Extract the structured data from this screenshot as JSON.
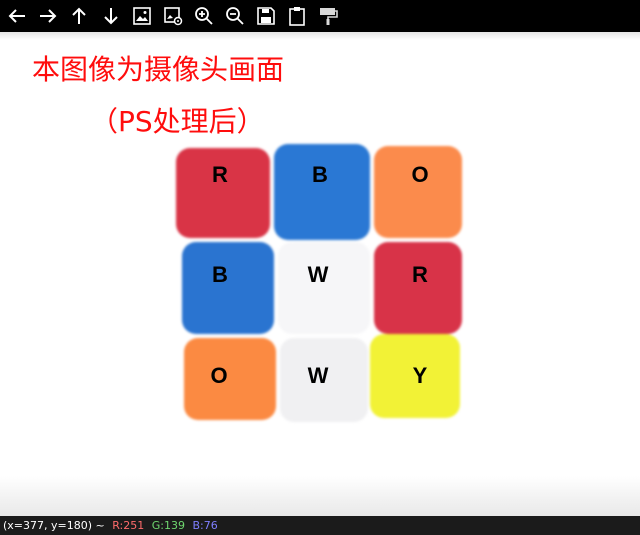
{
  "toolbar": {
    "buttons": [
      {
        "name": "back-button",
        "icon": "arrow-left-icon"
      },
      {
        "name": "forward-button",
        "icon": "arrow-right-icon"
      },
      {
        "name": "up-button",
        "icon": "arrow-up-icon"
      },
      {
        "name": "down-button",
        "icon": "arrow-down-icon"
      },
      {
        "name": "image-button",
        "icon": "image-icon"
      },
      {
        "name": "image-properties-button",
        "icon": "image-settings-icon"
      },
      {
        "name": "zoom-in-button",
        "icon": "zoom-in-icon"
      },
      {
        "name": "zoom-out-button",
        "icon": "zoom-out-icon"
      },
      {
        "name": "save-button",
        "icon": "save-icon"
      },
      {
        "name": "clipboard-button",
        "icon": "clipboard-icon"
      },
      {
        "name": "paint-button",
        "icon": "paint-roller-icon"
      }
    ]
  },
  "image": {
    "caption_line1": "本图像为摄像头画面",
    "caption_line2": "（PS处理后）",
    "cube_faces": [
      {
        "label": "R",
        "color": "#d93446"
      },
      {
        "label": "B",
        "color": "#2a78d4"
      },
      {
        "label": "O",
        "color": "#fb8b4c"
      },
      {
        "label": "B",
        "color": "#2a74d0"
      },
      {
        "label": "W",
        "color": "#f6f6f8"
      },
      {
        "label": "R",
        "color": "#d83348"
      },
      {
        "label": "O",
        "color": "#fb8a42"
      },
      {
        "label": "W",
        "color": "#f0f0f2"
      },
      {
        "label": "Y",
        "color": "#f2f236"
      }
    ]
  },
  "status": {
    "coords": "(x=377, y=180) ~",
    "r": "R:251",
    "g": "G:139",
    "b": "B:76",
    "r_color": "#ff6b6b",
    "g_color": "#6fd66f",
    "b_color": "#7f7fff"
  }
}
